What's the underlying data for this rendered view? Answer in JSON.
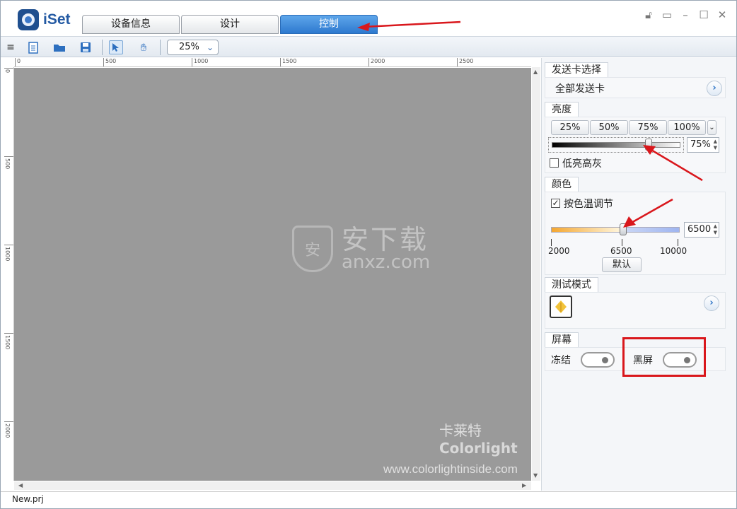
{
  "app": {
    "name": "iSet"
  },
  "tabs": [
    {
      "label": "设备信息"
    },
    {
      "label": "设计"
    },
    {
      "label": "控制",
      "active": true
    }
  ],
  "toolbar": {
    "zoom": "25%"
  },
  "ruler": {
    "h_labels": [
      "0",
      "500",
      "1000",
      "1500",
      "2000",
      "2500"
    ],
    "v_labels": [
      "0",
      "500",
      "1000",
      "1500",
      "2000"
    ]
  },
  "canvas": {
    "watermark_cn": "安下载",
    "watermark_en": "anxz.com",
    "watermark_shield": "安",
    "brand_cn": "卡莱特",
    "brand_en": "Colorlight",
    "url": "www.colorlightinside.com"
  },
  "status": {
    "file": "New.prj"
  },
  "panel": {
    "card": {
      "title": "发送卡选择",
      "value": "全部发送卡"
    },
    "brightness": {
      "title": "亮度",
      "presets": [
        "25%",
        "50%",
        "75%",
        "100%"
      ],
      "value": "75%",
      "level": 0.75,
      "low_gray_label": "低亮高灰"
    },
    "color": {
      "title": "颜色",
      "checkbox_label": "按色温调节",
      "value": "6500",
      "scale": [
        "2000",
        "6500",
        "10000"
      ],
      "default_button": "默认"
    },
    "test": {
      "title": "测试模式"
    },
    "screen": {
      "title": "屏幕",
      "freeze_label": "冻结",
      "black_label": "黑屏"
    }
  },
  "colors": {
    "accent": "#2d79cf",
    "highlight": "#d9171c"
  }
}
